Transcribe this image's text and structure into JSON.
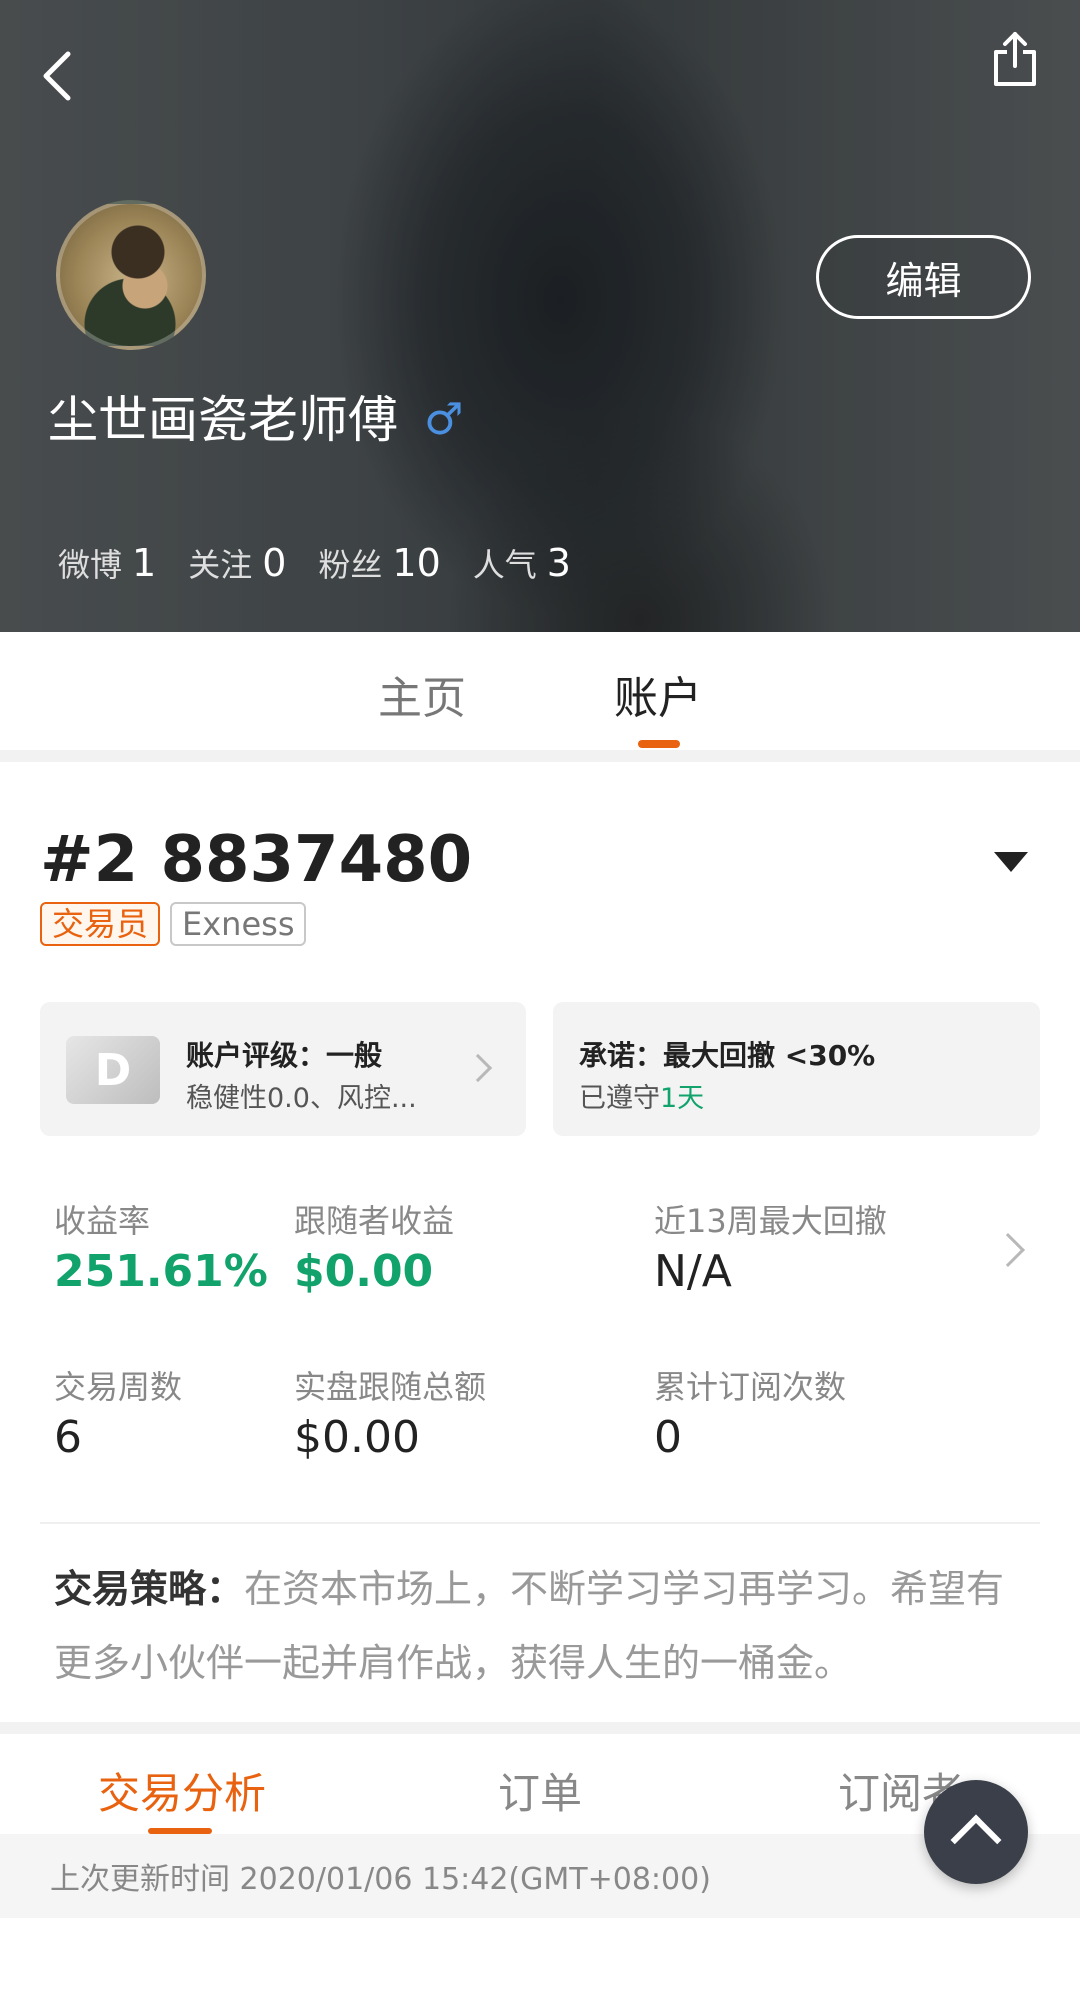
{
  "header": {
    "edit_label": "编辑",
    "username": "尘世画瓷老师傅",
    "gender_symbol": "♂",
    "stats": [
      {
        "label": "微博",
        "value": "1"
      },
      {
        "label": "关注",
        "value": "0"
      },
      {
        "label": "粉丝",
        "value": "10"
      },
      {
        "label": "人气",
        "value": "3"
      }
    ]
  },
  "tabs": [
    {
      "label": "主页",
      "active": false
    },
    {
      "label": "账户",
      "active": true
    }
  ],
  "account": {
    "number": "#2 8837480",
    "badges": [
      "交易员",
      "Exness"
    ],
    "rating_card": {
      "grade": "D",
      "title": "账户评级：一般",
      "subtitle": "稳健性0.0、风控..."
    },
    "promise_card": {
      "title": "承诺：最大回撤 <30%",
      "kept_prefix": "已遵守",
      "kept_value": "1天"
    }
  },
  "metrics": [
    {
      "label": "收益率",
      "value": "251.61%"
    },
    {
      "label": "跟随者收益",
      "value": "$0.00"
    },
    {
      "label": "近13周最大回撤",
      "value": "N/A"
    },
    {
      "label": "交易周数",
      "value": "6"
    },
    {
      "label": "实盘跟随总额",
      "value": "$0.00"
    },
    {
      "label": "累计订阅次数",
      "value": "0"
    }
  ],
  "strategy": {
    "label": "交易策略：",
    "text": "在资本市场上，不断学习学习再学习。希望有更多小伙伴一起并肩作战，获得人生的一桶金。"
  },
  "sub_tabs": [
    {
      "label": "交易分析",
      "active": true
    },
    {
      "label": "订单",
      "active": false
    },
    {
      "label": "订阅者",
      "active": false
    }
  ],
  "last_update": "上次更新时间 2020/01/06 15:42(GMT+08:00)",
  "colors": {
    "accent": "#e8620f",
    "positive": "#11a36b",
    "gender": "#4a8fe0",
    "fab": "#3a3f4a"
  },
  "icons": [
    "back-icon",
    "share-icon",
    "male-icon",
    "dropdown-icon",
    "chevron-right-icon",
    "chevron-up-icon"
  ]
}
